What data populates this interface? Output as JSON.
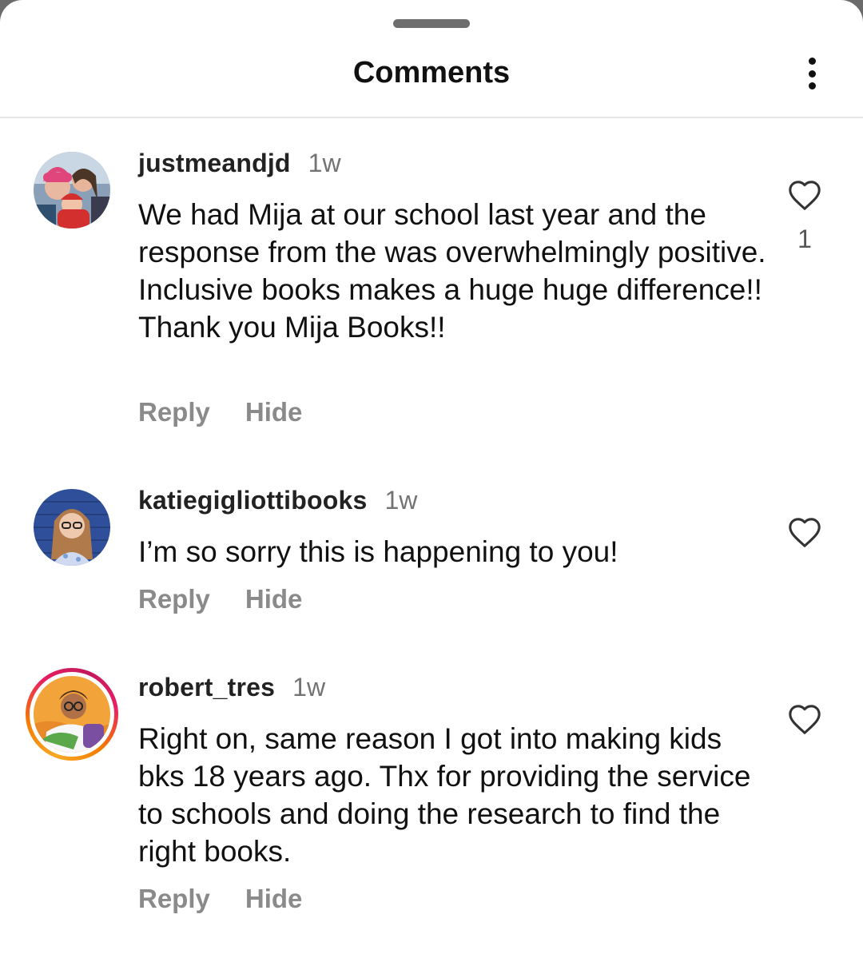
{
  "header": {
    "title": "Comments"
  },
  "comments": [
    {
      "username": "justmeandjd",
      "time": "1w",
      "text": "We had Mija at our school last year and the response from the was overwhelmingly positive. Inclusive books makes a huge huge difference!! Thank you Mija Books!!",
      "like_count": "1",
      "reply_label": "Reply",
      "hide_label": "Hide"
    },
    {
      "username": "katiegigliottibooks",
      "time": "1w",
      "text": "I’m so sorry this is happening to you!",
      "reply_label": "Reply",
      "hide_label": "Hide"
    },
    {
      "username": "robert_tres",
      "time": "1w",
      "text": "Right on, same reason I got into making kids bks 18 years ago. Thx for providing the service to schools and doing the research to find the right books.",
      "reply_label": "Reply",
      "hide_label": "Hide"
    }
  ],
  "icons": {
    "more": "more-vertical-icon",
    "like": "heart-outline-icon"
  },
  "colors": {
    "story_ring_start": "#f9a825",
    "story_ring_end": "#e91e63",
    "secondary_text": "#8a8a8a"
  }
}
